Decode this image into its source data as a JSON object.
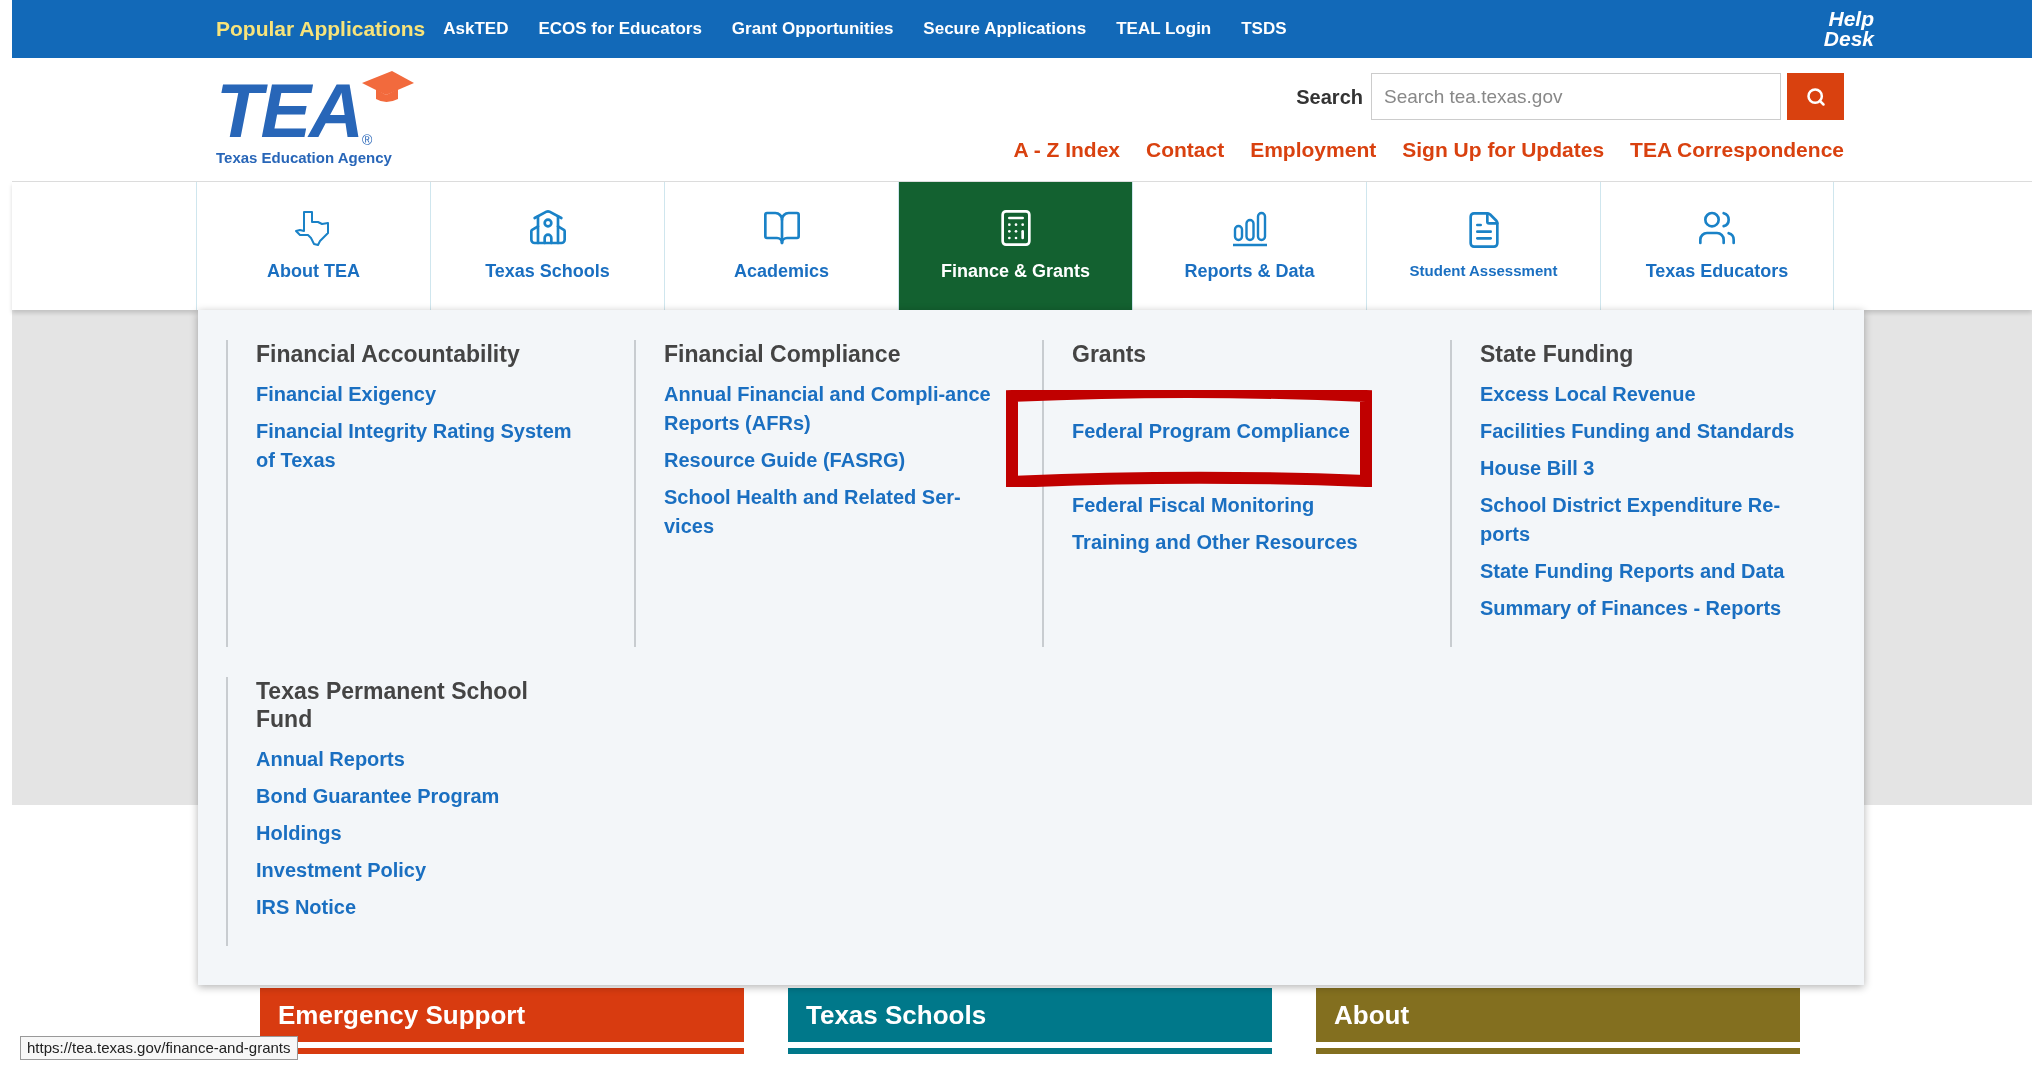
{
  "top_bar": {
    "title": "Popular Applications",
    "links": [
      "AskTED",
      "ECOS for Educators",
      "Grant Opportunities",
      "Secure Applications",
      "TEAL Login",
      "TSDS"
    ],
    "help_desk": [
      "Help",
      "Desk"
    ]
  },
  "header": {
    "logo": {
      "letters": "TEA",
      "registered": "®",
      "subtitle": "Texas Education Agency"
    },
    "search": {
      "label": "Search",
      "placeholder": "Search tea.texas.gov"
    },
    "links": [
      "A - Z Index",
      "Contact",
      "Employment",
      "Sign Up for Updates",
      "TEA Correspondence"
    ]
  },
  "nav": [
    {
      "label": "About TEA",
      "kind": "texas",
      "selected": false
    },
    {
      "label": "Texas Schools",
      "kind": "school",
      "selected": false
    },
    {
      "label": "Academics",
      "kind": "book",
      "selected": false
    },
    {
      "label": "Finance & Grants",
      "kind": "calculator",
      "selected": true
    },
    {
      "label": "Reports & Data",
      "kind": "bars",
      "selected": false
    },
    {
      "label": "Student Assessment",
      "kind": "document",
      "selected": false
    },
    {
      "label": "Texas Educators",
      "kind": "people",
      "selected": false
    }
  ],
  "mega_menu": {
    "sections": [
      {
        "heading": "Financial Accountability",
        "links": [
          {
            "kind": "link",
            "text": "Financial Exigency"
          },
          {
            "kind": "link",
            "text": "Financial Integrity Rating System of Texas"
          }
        ]
      },
      {
        "heading": "Financial Compliance",
        "links": [
          {
            "kind": "link",
            "text": "Annual Financial and Compli-ance Reports (AFRs)"
          },
          {
            "kind": "link",
            "text": "Resource Guide (FASRG)"
          },
          {
            "kind": "link",
            "text": "School Health and Related Ser-vices"
          }
        ]
      },
      {
        "heading": "Grants",
        "links": [
          {
            "kind": "covered"
          },
          {
            "kind": "link",
            "text": "Federal Program Compliance"
          },
          {
            "kind": "covered"
          },
          {
            "kind": "link",
            "text": "Federal Fiscal Monitoring"
          },
          {
            "kind": "link",
            "text": "Training and Other Resources"
          }
        ]
      },
      {
        "heading": "State Funding",
        "links": [
          {
            "kind": "link",
            "text": "Excess Local Revenue"
          },
          {
            "kind": "link",
            "text": "Facilities Funding and Standards"
          },
          {
            "kind": "link",
            "text": "House Bill 3"
          },
          {
            "kind": "link",
            "text": "School District Expenditure Re-ports"
          },
          {
            "kind": "link",
            "text": "State Funding Reports and Data"
          },
          {
            "kind": "link",
            "text": "Summary of Finances - Reports"
          }
        ]
      },
      {
        "heading": "Texas Permanent School Fund",
        "links": [
          {
            "kind": "link",
            "text": "Annual Reports"
          },
          {
            "kind": "link",
            "text": "Bond Guarantee Program"
          },
          {
            "kind": "link",
            "text": "Holdings"
          },
          {
            "kind": "link",
            "text": "Investment Policy"
          },
          {
            "kind": "link",
            "text": "IRS Notice"
          }
        ]
      }
    ]
  },
  "cards": [
    {
      "title": "Emergency Support",
      "color": "#d83b10"
    },
    {
      "title": "Texas Schools",
      "color": "#00788a"
    },
    {
      "title": "About",
      "color": "#836f1f"
    }
  ],
  "status_url": "https://tea.texas.gov/finance-and-grants"
}
